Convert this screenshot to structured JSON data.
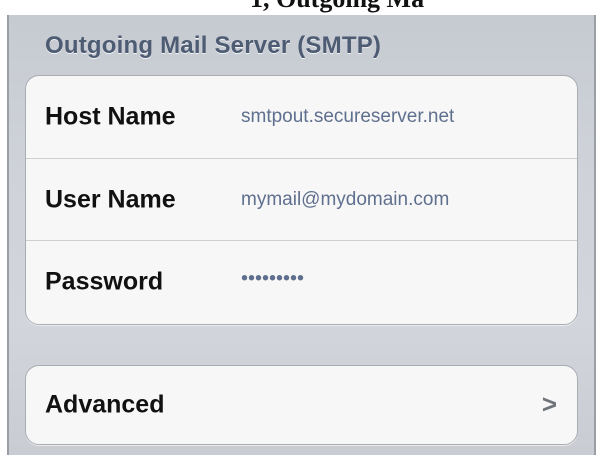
{
  "page_header": {
    "caption_fragment": "1, Outgoing Ma"
  },
  "smtp_section": {
    "title": "Outgoing Mail Server (SMTP)",
    "fields": [
      {
        "label": "Host Name",
        "value": "smtpout.secureserver.net"
      },
      {
        "label": "User Name",
        "value": "mymail@mydomain.com"
      },
      {
        "label": "Password",
        "value": "•••••••••"
      }
    ]
  },
  "advanced": {
    "label": "Advanced",
    "chevron": ">",
    "icon": "chevron-right-icon"
  },
  "colors": {
    "section_header": "#4d5b73",
    "value_text": "#5f6f8e",
    "background": "#cfd3d9"
  }
}
